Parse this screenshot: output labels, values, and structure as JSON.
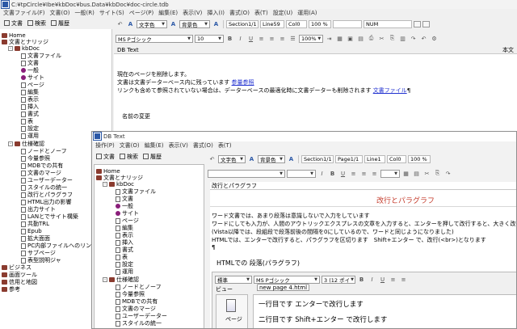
{
  "back_window": {
    "title": "C:¥tpCircle¥Ibe¥kbDoc¥bus.Data¥kbDoc¥doc-circle.tdb",
    "menu": [
      "文書ファイル(F)",
      "文書(O)",
      "一般(R)",
      "サイト(S)",
      "ページ(P)",
      "編集(E)",
      "表示(V)",
      "挿入(I)",
      "書式(O)",
      "表(T)",
      "設定(U)",
      "運用(A)"
    ],
    "tabs": [
      "文書",
      "検索",
      "履歴"
    ],
    "style_select": "文字色",
    "bg_select": "背景色",
    "section_field": "Section1/1",
    "line_field": "Line59",
    "col_field": "Col0",
    "zoom_field": "100 %",
    "num_field": "NUM",
    "font_select": "MS Pゴシック",
    "size_select": "10",
    "zoom_select": "100%",
    "tree": [
      "Home",
      "文書とナリッジ",
      "kbDoc",
      "文書ファイル",
      "文書",
      "一般",
      "サイト",
      "ページ",
      "編集",
      "表示",
      "挿入",
      "書式",
      "表",
      "設定",
      "運用",
      "仕様確認",
      "ノードとノーフ",
      "今量参照",
      "MDBでの共有",
      "文書のマージ",
      "ユーザーデーター",
      "スタイルの統一",
      "改行とパラグラフ",
      "HTML出力の影響",
      "出力サイト",
      "LANとでサイト構築",
      "共勤TRL",
      "Epub",
      "拡大面面",
      "PC内部ファイルへのリン",
      "サブページ",
      "表型説明ジャ",
      "ビジネス",
      "画面ツール",
      "信用と地図",
      "参考"
    ],
    "doc_label": "DB Text",
    "doc_header_right": "本文",
    "doc_lines": [
      "現在のページを削除します。",
      "文書は文書データーベース内に残っています",
      "リンクも含めて参照されていない場合は、データーベースの最適化時に文書データーも削除されます"
    ],
    "link_ref": "参量参照",
    "link_file": "文書ファイル",
    "doc_heading": "名前の変更"
  },
  "front_window": {
    "title": "DB Text",
    "menu": [
      "操作(P)",
      "文書(O)",
      "編集(E)",
      "表示(V)",
      "書式(O)",
      "表(T)"
    ],
    "tabs": [
      "文書",
      "検索",
      "履歴"
    ],
    "style_select": "文字色",
    "bg_select": "背景色",
    "section_field": "Section1/1",
    "page_field": "Page1/1",
    "line_field": "Line1",
    "col_field": "Col0",
    "zoom_field": "100 %",
    "tree": [
      "Home",
      "文書とナリッジ",
      "kbDoc",
      "文書ファイル",
      "文書",
      "一般",
      "サイト",
      "ページ",
      "編集",
      "表示",
      "挿入",
      "書式",
      "表",
      "設定",
      "運用",
      "仕様確認",
      "ノードとノーフ",
      "今量参照",
      "MDBでの共有",
      "文書のマージ",
      "ユーザーデーター",
      "スタイルの統一"
    ],
    "doc_title": "改行とパラグラフ",
    "doc_heading": "改行とパラグラフ",
    "doc_lines": [
      "ワード文書では、あまり段落は意識しないで入力をしています",
      "ワードにしても入力が、人間のアウトリックエクスプレスの文章を入力すると、エンターを押して改行すると、大きく改行",
      "(Vista以降では、段組段で段落前後の間隔を0にしているので、ワードと同じようになりました)",
      "HTMLでは、エンターで改行すると、パラグラフを区切ります　Shift+エンター で、改行(<br>)となります",
      "¶"
    ],
    "html_heading": "HTMLでの 段落(パラグラフ)",
    "inner": {
      "style_select": "標準",
      "font_select": "MS Pゴシック",
      "size_select": "3 (12 ポイ",
      "view_label": "ビュー",
      "tab_label": "new page 4.html",
      "page_label": "ページ",
      "lines": [
        "一行目です エンターで改行します",
        "二行目です Shift+エンター で改行します"
      ]
    }
  },
  "colors": {
    "accent": "#2b58a6",
    "heading_red": "#c43a2a",
    "link": "#2030d0",
    "folder": "#8a3b2f",
    "page_dot": "#8a1e7a"
  }
}
